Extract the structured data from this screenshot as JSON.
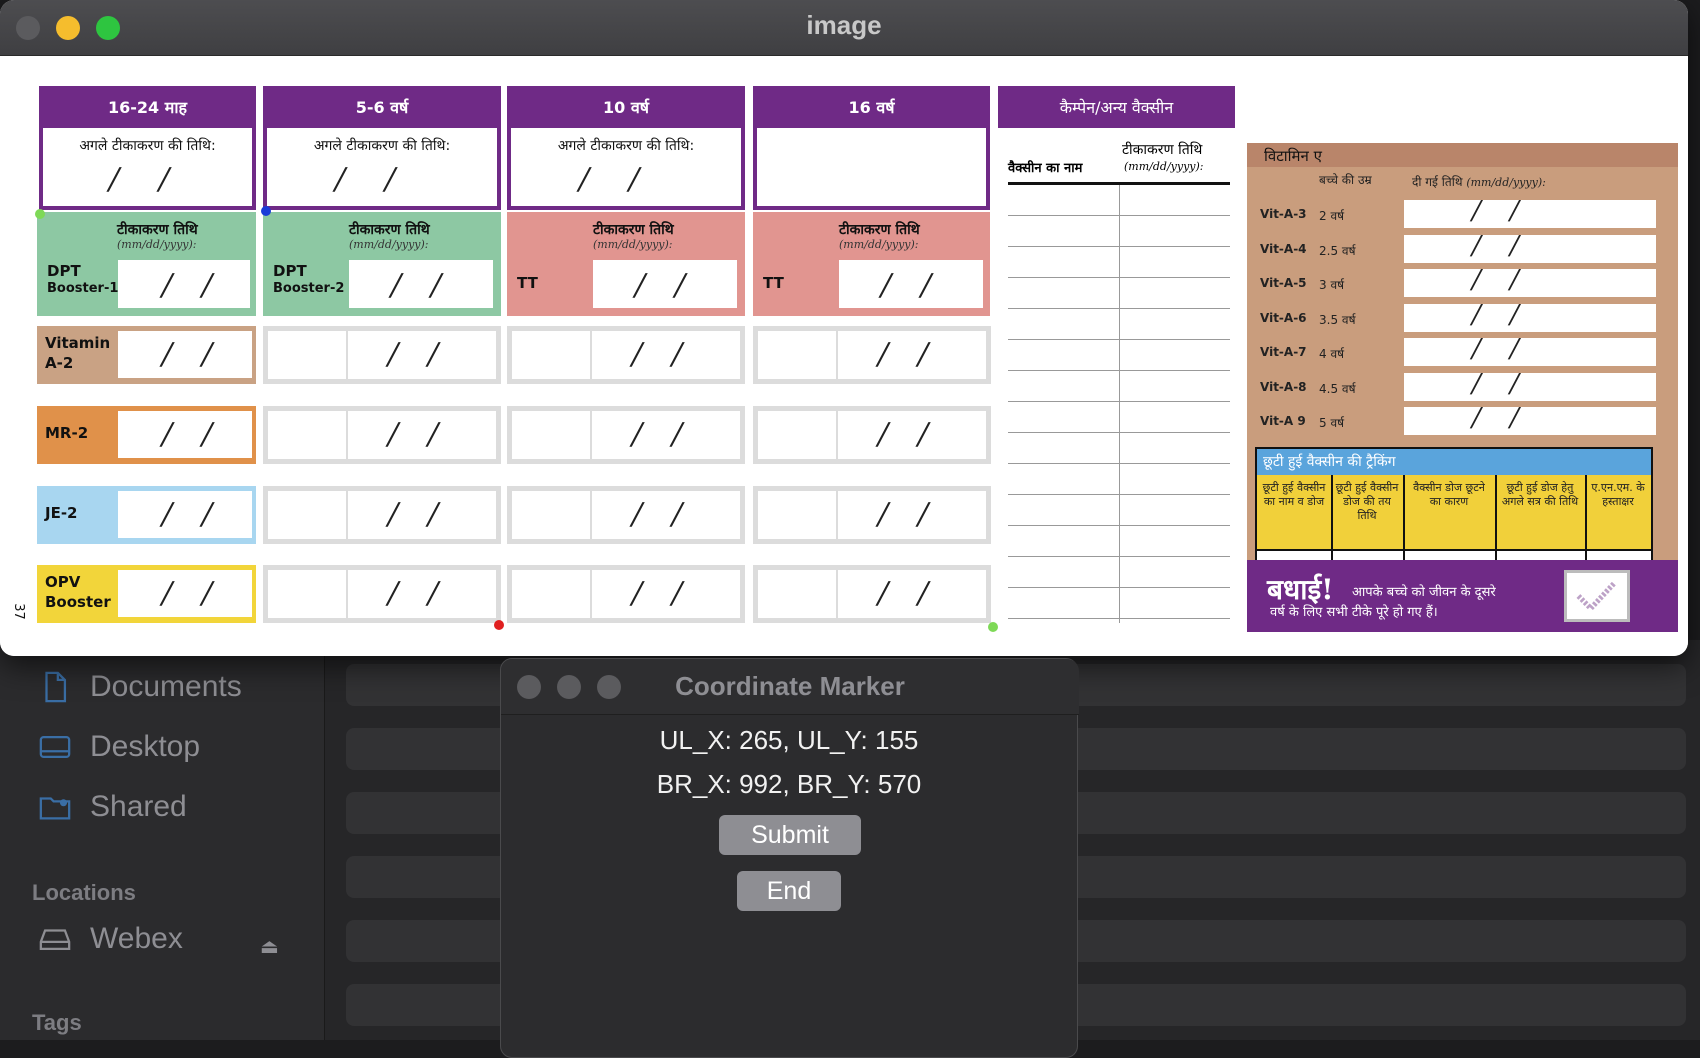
{
  "window": {
    "title": "image"
  },
  "finder": {
    "items": [
      "Documents",
      "Desktop",
      "Shared"
    ],
    "locations_heading": "Locations",
    "location_item": "Webex",
    "tags_heading": "Tags"
  },
  "form": {
    "side_number": "37",
    "columns": [
      {
        "header": "16-24 माह",
        "next_label": "अगले टीकाकरण की तिथि:",
        "vac_label": "टीकाकरण तिथि",
        "date_format": "(mm/dd/yyyy):",
        "vaccine_1": "DPT",
        "vaccine_2": "Booster-1"
      },
      {
        "header": "5-6 वर्ष",
        "next_label": "अगले टीकाकरण की तिथि:",
        "vac_label": "टीकाकरण तिथि",
        "date_format": "(mm/dd/yyyy):",
        "vaccine_1": "DPT",
        "vaccine_2": "Booster-2"
      },
      {
        "header": "10 वर्ष",
        "next_label": "अगले टीकाकरण की तिथि:",
        "vac_label": "टीकाकरण तिथि",
        "date_format": "(mm/dd/yyyy):",
        "vaccine_1": "TT",
        "vaccine_2": ""
      },
      {
        "header": "16 वर्ष",
        "next_label": "",
        "vac_label": "टीकाकरण तिथि",
        "date_format": "(mm/dd/yyyy):",
        "vaccine_1": "TT",
        "vaccine_2": ""
      }
    ],
    "rows": [
      {
        "label_1": "Vitamin",
        "label_2": "A-2",
        "color": "#c9a284"
      },
      {
        "label_1": "MR-2",
        "label_2": "",
        "color": "#e0914a"
      },
      {
        "label_1": "JE-2",
        "label_2": "",
        "color": "#a8d6f0"
      },
      {
        "label_1": "OPV",
        "label_2": "Booster",
        "color": "#f2d53a"
      }
    ],
    "campaign": {
      "header": "कैम्पेन/अन्य वैक्सीन",
      "vaccine_name": "वैक्सीन का नाम",
      "date_label": "टीकाकरण तिथि",
      "date_format": "(mm/dd/yyyy):"
    },
    "vitamin": {
      "title": "विटामिन ए",
      "age_header": "बच्चे की उम्र",
      "date_header": "दी गई तिथि",
      "date_format": "(mm/dd/yyyy):",
      "rows": [
        {
          "code": "Vit-A-3",
          "age": "2 वर्ष"
        },
        {
          "code": "Vit-A-4",
          "age": "2.5 वर्ष"
        },
        {
          "code": "Vit-A-5",
          "age": "3 वर्ष"
        },
        {
          "code": "Vit-A-6",
          "age": "3.5 वर्ष"
        },
        {
          "code": "Vit-A-7",
          "age": "4 वर्ष"
        },
        {
          "code": "Vit-A-8",
          "age": "4.5 वर्ष"
        },
        {
          "code": "Vit-A 9",
          "age": "5 वर्ष"
        }
      ]
    },
    "missed": {
      "title": "छूटी हुई वैक्सीन की ट्रैकिंग",
      "columns": [
        "छूटी हुई वैक्सीन का नाम व डोज",
        "छूटी हुई वैक्सीन डोज की तय तिथि",
        "वैक्सीन डोज छूटने का कारण",
        "छूटी हुई डोज हेतु अगले सत्र की तिथि",
        "ए.एन.एम. के हस्ताक्षर"
      ]
    },
    "congrats": {
      "title": "बधाई!",
      "text_1": "आपके बच्चे को जीवन के दूसरे",
      "text_2": "वर्ष के लिए सभी टीके पूरे हो गए हैं।"
    },
    "colors": {
      "purple": "#6f2a86",
      "green": "#8dc8a3",
      "salmon": "#e19590"
    }
  },
  "marker": {
    "title": "Coordinate Marker",
    "line_1": "UL_X: 265, UL_Y: 155",
    "line_2": "BR_X: 992, BR_Y: 570",
    "submit": "Submit",
    "end": "End"
  }
}
